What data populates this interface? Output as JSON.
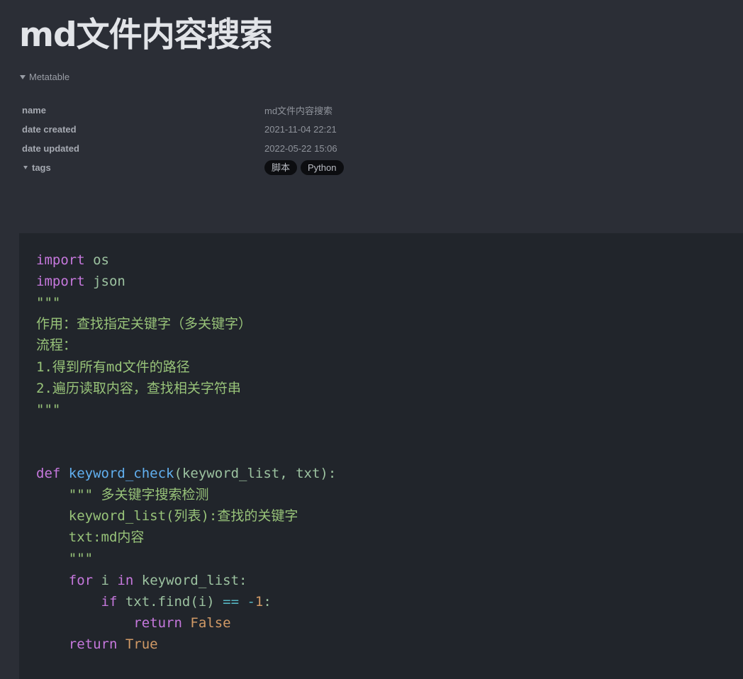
{
  "document": {
    "title": "md文件内容搜索"
  },
  "metatable": {
    "label": "Metatable",
    "rows": [
      {
        "key": "name",
        "value": "md文件内容搜索"
      },
      {
        "key": "date created",
        "value": "2021-11-04 22:21"
      },
      {
        "key": "date updated",
        "value": "2022-05-22 15:06"
      }
    ],
    "tags_key": "tags",
    "tags": [
      "脚本",
      "Python"
    ]
  },
  "code": {
    "language": "python",
    "lines": [
      [
        {
          "t": "import",
          "c": "kw"
        },
        {
          "t": " os",
          "c": "plain"
        }
      ],
      [
        {
          "t": "import",
          "c": "kw"
        },
        {
          "t": " json",
          "c": "plain"
        }
      ],
      [
        {
          "t": "\"\"\"",
          "c": "str"
        }
      ],
      [
        {
          "t": "作用：查找指定关键字（多关键字）",
          "c": "str"
        }
      ],
      [
        {
          "t": "流程：",
          "c": "str"
        }
      ],
      [
        {
          "t": "1.得到所有md文件的路径",
          "c": "str"
        }
      ],
      [
        {
          "t": "2.遍历读取内容，查找相关字符串",
          "c": "str"
        }
      ],
      [
        {
          "t": "\"\"\"",
          "c": "str"
        }
      ],
      [],
      [],
      [
        {
          "t": "def",
          "c": "kw"
        },
        {
          "t": " ",
          "c": "plain"
        },
        {
          "t": "keyword_check",
          "c": "fn"
        },
        {
          "t": "(keyword_list, txt):",
          "c": "plain"
        }
      ],
      [
        {
          "t": "    \"\"\" 多关键字搜索检测",
          "c": "str"
        }
      ],
      [
        {
          "t": "    keyword_list(列表):查找的关键字",
          "c": "str"
        }
      ],
      [
        {
          "t": "    txt:md内容",
          "c": "str"
        }
      ],
      [
        {
          "t": "    \"\"\"",
          "c": "str"
        }
      ],
      [
        {
          "t": "    ",
          "c": "plain"
        },
        {
          "t": "for",
          "c": "kw"
        },
        {
          "t": " i ",
          "c": "plain"
        },
        {
          "t": "in",
          "c": "kw"
        },
        {
          "t": " keyword_list:",
          "c": "plain"
        }
      ],
      [
        {
          "t": "        ",
          "c": "plain"
        },
        {
          "t": "if",
          "c": "kw"
        },
        {
          "t": " txt.find(i) ",
          "c": "plain"
        },
        {
          "t": "==",
          "c": "op"
        },
        {
          "t": " ",
          "c": "plain"
        },
        {
          "t": "-",
          "c": "op"
        },
        {
          "t": "1",
          "c": "num"
        },
        {
          "t": ":",
          "c": "plain"
        }
      ],
      [
        {
          "t": "            ",
          "c": "plain"
        },
        {
          "t": "return",
          "c": "kw"
        },
        {
          "t": " ",
          "c": "plain"
        },
        {
          "t": "False",
          "c": "num"
        }
      ],
      [
        {
          "t": "    ",
          "c": "plain"
        },
        {
          "t": "return",
          "c": "kw"
        },
        {
          "t": " ",
          "c": "plain"
        },
        {
          "t": "True",
          "c": "num"
        }
      ]
    ]
  },
  "colors": {
    "background": "#2b2e36",
    "code_background": "#21252b",
    "keyword": "#c678dd",
    "string": "#98c379",
    "function": "#61afef",
    "number": "#d19a66"
  }
}
